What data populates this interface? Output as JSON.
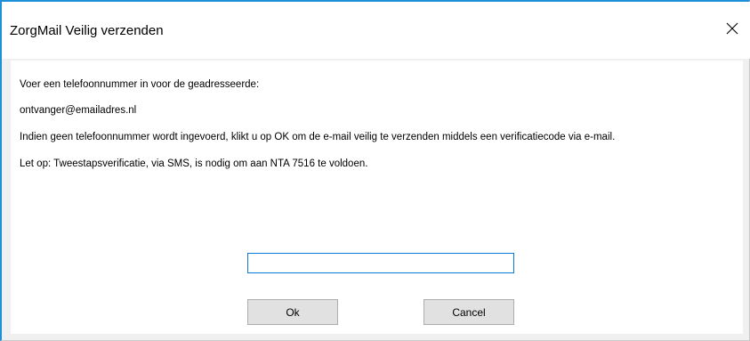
{
  "window": {
    "title": "ZorgMail Veilig verzenden"
  },
  "icons": {
    "close": "close-icon"
  },
  "messages": {
    "prompt": "Voer een telefoonnummer in voor de geadresseerde:",
    "recipient": "ontvanger@emailadres.nl",
    "info": "Indien geen telefoonnummer wordt ingevoerd, klikt u op OK om de e-mail veilig te verzenden middels een verificatiecode via e-mail.",
    "notice": "Let op: Tweestapsverificatie, via SMS, is nodig om aan NTA 7516 te voldoen."
  },
  "phone_input": {
    "value": "",
    "placeholder": ""
  },
  "buttons": {
    "ok": "Ok",
    "cancel": "Cancel"
  },
  "colors": {
    "accent": "#1e90d8",
    "input_focus_border": "#0a78d7",
    "button_bg": "#e1e1e1",
    "dialog_bg": "#f0f0f0"
  }
}
